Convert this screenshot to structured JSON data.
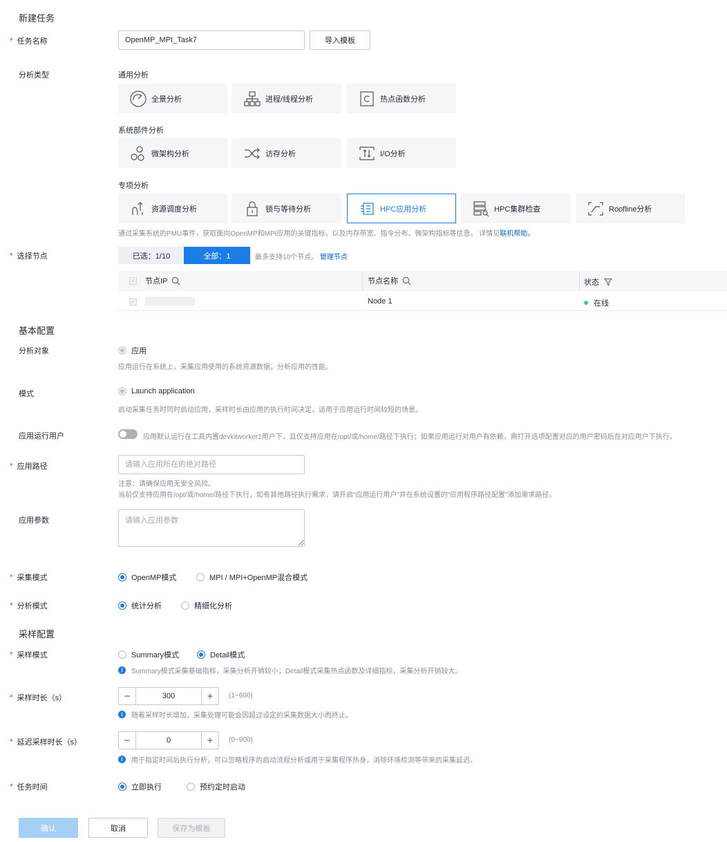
{
  "sections": {
    "new_task": "新建任务",
    "basic_config": "基本配置",
    "sampling_config": "采样配置"
  },
  "task_name": {
    "label": "任务名称",
    "value": "OpenMP_MPI_Task7",
    "import_button": "导入模板"
  },
  "analysis_type": {
    "label": "分析类型",
    "groups": [
      {
        "title": "通用分析",
        "items": [
          {
            "label": "全景分析",
            "icon": "gauge-icon"
          },
          {
            "label": "进程/线程分析",
            "icon": "process-tree-icon"
          },
          {
            "label": "热点函数分析",
            "icon": "function-c-icon"
          }
        ]
      },
      {
        "title": "系统部件分析",
        "items": [
          {
            "label": "微架构分析",
            "icon": "microarch-icon"
          },
          {
            "label": "访存分析",
            "icon": "shuffle-icon"
          },
          {
            "label": "I/O分析",
            "icon": "io-icon"
          }
        ]
      },
      {
        "title": "专项分析",
        "items": [
          {
            "label": "资源调度分析",
            "icon": "resource-schedule-icon"
          },
          {
            "label": "锁与等待分析",
            "icon": "lock-icon"
          },
          {
            "label": "HPC应用分析",
            "icon": "hpc-app-icon",
            "selected": true
          },
          {
            "label": "HPC集群检查",
            "icon": "cluster-check-icon"
          },
          {
            "label": "Roofline分析",
            "icon": "roofline-icon"
          }
        ]
      }
    ],
    "description_prefix": "通过采集系统的PMU事件，获取面向OpenMP和MPI应用的关键指标，以及内存带宽、指令分布、微架构指标等信息。 详情见",
    "description_link": "联机帮助。"
  },
  "node_select": {
    "label": "选择节点",
    "selected_tab": "已选：1/10",
    "all_tab": "全部：1",
    "hint": "最多支持10个节点。",
    "manage_link": "管理节点",
    "columns": [
      "节点IP",
      "节点名称",
      "状态"
    ],
    "rows": [
      {
        "ip": "",
        "name": "Node 1",
        "status": "在线"
      }
    ],
    "status_color": "#3dcc93"
  },
  "target": {
    "label": "分析对象",
    "option": "应用",
    "desc": "应用运行在系统上，采集应用使用的系统资源数据，分析应用的性能。"
  },
  "mode": {
    "label": "模式",
    "option": "Launch application",
    "desc": "启动采集任务时同时启动应用，采样时长由应用的执行时间决定，适用于应用运行时间较短的场景。"
  },
  "run_user": {
    "label": "应用运行用户",
    "desc": "应用默认运行在工具内置devkitworker1用户下，且仅支持应用在/opt/或/home/路径下执行；如果应用运行对用户有依赖，需打开选项配置对应的用户密码后在对应用户下执行。"
  },
  "app_path": {
    "label": "应用路径",
    "placeholder": "请输入应用所在的绝对路径",
    "note1": "注意：请确保应用无安全风险。",
    "note2": "当前仅支持应用在/opt/或/home/路径下执行，如有其他路径执行需求，请开启“应用运行用户”并在系统设置的“应用程序路径配置”添加需求路径。"
  },
  "app_params": {
    "label": "应用参数",
    "placeholder": "请输入应用参数"
  },
  "collect_mode": {
    "label": "采集模式",
    "options": [
      "OpenMP模式",
      "MPI / MPI+OpenMP混合模式"
    ]
  },
  "analysis_mode": {
    "label": "分析模式",
    "options": [
      "统计分析",
      "精细化分析"
    ]
  },
  "sample_mode": {
    "label": "采样模式",
    "options": [
      "Summary模式",
      "Detail模式"
    ],
    "info": "Summary模式采集基础指标，采集分析开销较小；Detail模式采集热点函数及详细指标，采集分析开销较大。"
  },
  "sample_duration": {
    "label": "采样时长（s）",
    "value": "300",
    "range": "(1~600)",
    "info": "随着采样时长增加，采集处理可能会因超过设定的采集数据大小而终止。"
  },
  "delay_duration": {
    "label": "延迟采样时长（s）",
    "value": "0",
    "range": "(0~900)",
    "info": "用于指定时间后执行分析，可以忽略程序的启动流程分析或用于采集程序热身，消除环境检测等带来的采集延迟。"
  },
  "task_time": {
    "label": "任务时间",
    "options": [
      "立即执行",
      "预约定时启动"
    ]
  },
  "footer": {
    "confirm": "确认",
    "cancel": "取消",
    "save_template": "保存为模板"
  },
  "colors": {
    "primary": "#1a7ee6",
    "required": "#e54545",
    "link": "#0067d1"
  }
}
